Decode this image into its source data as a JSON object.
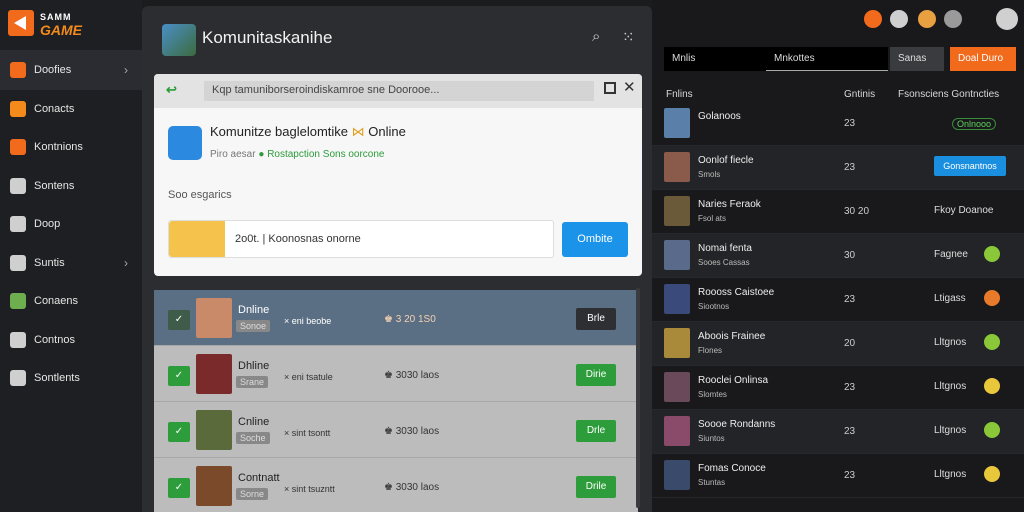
{
  "app": {
    "logo_top": "SAMM",
    "logo_bottom": "GAME"
  },
  "sidebar": {
    "items": [
      {
        "label": "Doofies",
        "icon": "home-icon",
        "chevron": "›"
      },
      {
        "label": "Conacts",
        "icon": "contacts-icon",
        "chevron": ""
      },
      {
        "label": "Kontnions",
        "icon": "community-icon",
        "chevron": ""
      },
      {
        "label": "Sontens",
        "icon": "controller-icon",
        "chevron": ""
      },
      {
        "label": "Doop",
        "icon": "shield-icon",
        "chevron": ""
      },
      {
        "label": "Suntis",
        "icon": "chart-icon",
        "chevron": "›"
      },
      {
        "label": "Conaens",
        "icon": "globe-icon",
        "chevron": ""
      },
      {
        "label": "Contnos",
        "icon": "info-icon",
        "chevron": ""
      },
      {
        "label": "Sontlents",
        "icon": "gear-icon",
        "chevron": ""
      }
    ]
  },
  "main": {
    "title": "Komunitaskanihe",
    "search_icon": "search-icon",
    "options_icon": "options-icon"
  },
  "dialog": {
    "back_icon": "back-arrow-icon",
    "url": "Kqp tamuniborseroindiskamroe sne Doorooe...",
    "app_name": "Komunitze baglelomtike",
    "app_status": "Online",
    "sub_prefix": "Piro aesar",
    "sub_link": "Rostapction Sons oorcone",
    "section_label": "Soo esgarics",
    "input_value": "2o0t. | Koonosnas onorne",
    "submit_label": "Ombite"
  },
  "list": {
    "rows": [
      {
        "name": "Dnline",
        "tag": "Sonoe",
        "meta": "× eni beobe",
        "score": "3 20 1S0",
        "button": "Brle",
        "selected": true,
        "avatar_color": "#c98a6a"
      },
      {
        "name": "Dhline",
        "tag": "Srane",
        "meta": "× eni tsatule",
        "score": "3030 laos",
        "button": "Dirie",
        "selected": false,
        "avatar_color": "#7a2a2a"
      },
      {
        "name": "Cnline",
        "tag": "Soche",
        "meta": "× sint tsontt",
        "score": "3030 laos",
        "button": "Drle",
        "selected": false,
        "avatar_color": "#5a6a3a"
      },
      {
        "name": "Contnatt",
        "tag": "Sorne",
        "meta": "× sint tsuzntt",
        "score": "3030 laos",
        "button": "Drile",
        "selected": false,
        "avatar_color": "#7a4a2a"
      }
    ]
  },
  "right": {
    "tabs": [
      {
        "label": "Mnlis"
      },
      {
        "label": "Mnkottes"
      },
      {
        "label": "Sanas"
      },
      {
        "label": "Doal Duro"
      }
    ],
    "col_heads": {
      "name": "Fnlins",
      "status": "Gntinis",
      "actions": "Fsonsciens Gontncties"
    },
    "rows": [
      {
        "name": "Golanoos",
        "sub": "",
        "stat": "23",
        "action": "",
        "btn": "",
        "online": "Onlnooo",
        "avatar_color": "#5a7fa8",
        "badge_color": ""
      },
      {
        "name": "Oonlof fiecle",
        "sub": "Smols",
        "stat": "23",
        "action": "",
        "btn": "Gonsnantnos",
        "online": "",
        "avatar_color": "#8a5a4a",
        "badge_color": ""
      },
      {
        "name": "Naries Feraok",
        "sub": "Fsol ats",
        "stat": "30 20",
        "action": "Fkoy Doanoe",
        "btn": "",
        "online": "",
        "avatar_color": "#6a5a3a",
        "badge_color": ""
      },
      {
        "name": "Nomai fenta",
        "sub": "Sooes Cassas",
        "stat": "30",
        "action": "Fagnee",
        "btn": "",
        "online": "",
        "avatar_color": "#5a6a8a",
        "badge_color": "#8ac83a"
      },
      {
        "name": "Roooss Caistoee",
        "sub": "Siootnos",
        "stat": "23",
        "action": "Ltigass",
        "btn": "",
        "online": "",
        "avatar_color": "#3a4a7a",
        "badge_color": "#e87a2a"
      },
      {
        "name": "Aboois Frainee",
        "sub": "Flones",
        "stat": "20",
        "action": "Lltgnos",
        "btn": "",
        "online": "",
        "avatar_color": "#a88a3a",
        "badge_color": "#8ac83a"
      },
      {
        "name": "Rooclei Onlinsa",
        "sub": "Slomtes",
        "stat": "23",
        "action": "Lltgnos",
        "btn": "",
        "online": "",
        "avatar_color": "#6a4a5a",
        "badge_color": "#e8c83a"
      },
      {
        "name": "Soooe Rondanns",
        "sub": "Siuntos",
        "stat": "23",
        "action": "Lltgnos",
        "btn": "",
        "online": "",
        "avatar_color": "#8a4a6a",
        "badge_color": "#8ac83a"
      },
      {
        "name": "Fomas Conoce",
        "sub": "Stuntas",
        "stat": "23",
        "action": "Lltgnos",
        "btn": "",
        "online": "",
        "avatar_color": "#3a4a6a",
        "badge_color": "#e8c83a"
      }
    ]
  },
  "topbar_icons": [
    "notification-icon",
    "chat-icon",
    "avatar-icon",
    "settings-icon",
    "profile-icon"
  ]
}
